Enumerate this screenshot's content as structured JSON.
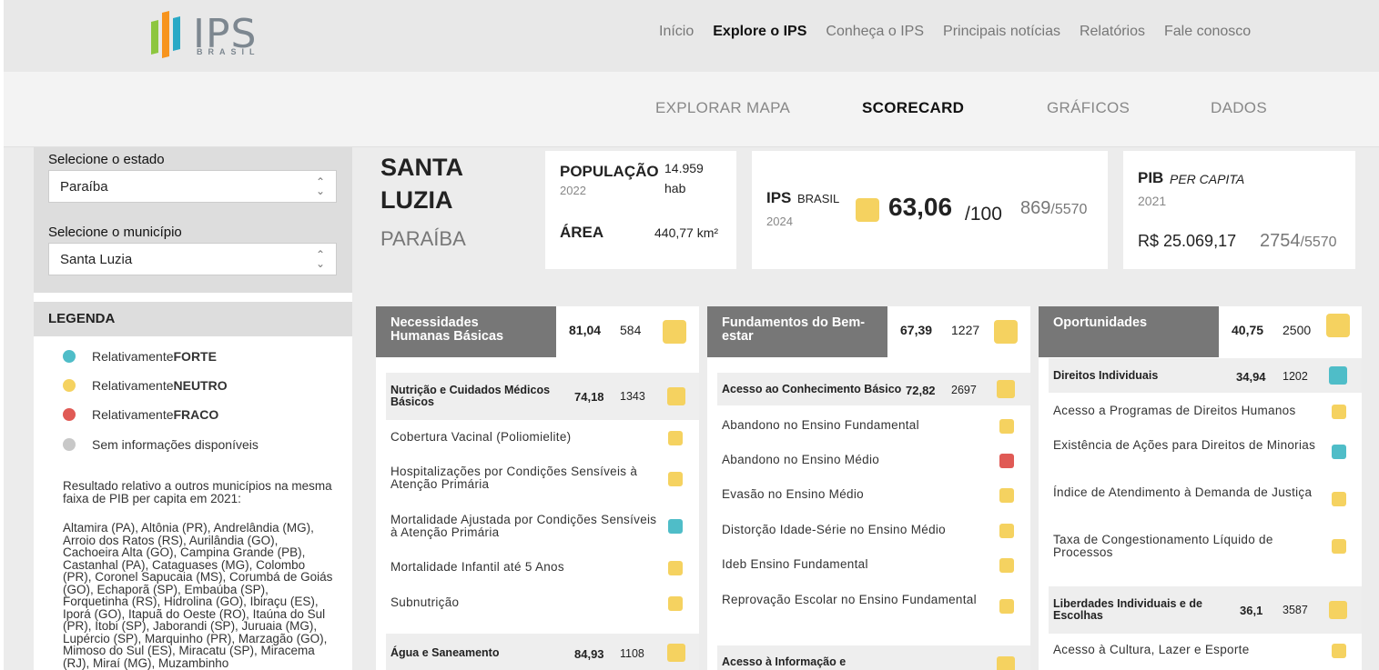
{
  "colors": {
    "forte": "#4fbdc8",
    "neutro": "#f5d260",
    "fraco": "#e05a55",
    "sem_info": "#c8c8c8"
  },
  "logo": {
    "text": "IPS",
    "sub": "BRASIL"
  },
  "nav": {
    "items": [
      "Início",
      "Explore o IPS",
      "Conheça o IPS",
      "Principais notícias",
      "Relatórios",
      "Fale conosco"
    ],
    "active": "Explore o IPS"
  },
  "subnav": {
    "mapa": "EXPLORAR MAPA",
    "scorecard": "SCORECARD",
    "graficos": "GRÁFICOS",
    "dados": "DADOS"
  },
  "sidebar": {
    "estado_label": "Selecione o estado",
    "estado_value": "Paraíba",
    "municipio_label": "Selecione o município",
    "municipio_value": "Santa Luzia",
    "legend_title": "LEGENDA",
    "legend": [
      {
        "prefix": "Relativamente ",
        "bold": "FORTE",
        "color": "forte"
      },
      {
        "prefix": "Relativamente ",
        "bold": "NEUTRO",
        "color": "neutro"
      },
      {
        "prefix": "Relativamente ",
        "bold": "FRACO",
        "color": "fraco"
      },
      {
        "prefix": "Sem informações disponíveis",
        "bold": "",
        "color": "sem_info"
      }
    ],
    "note": "Resultado relativo a outros municípios na mesma faixa de PIB per capita em 2021:",
    "municipios": "Altamira (PA), Altônia (PR), Andrelândia (MG), Arroio dos Ratos (RS), Aurilândia (GO), Cachoeira Alta (GO), Campina Grande (PB), Castanhal (PA), Cataguases (MG), Colombo (PR), Coronel Sapucaia (MS), Corumbá de Goiás (GO), Echaporã (SP), Embaúba (SP), Forquetinha (RS), Hidrolina (GO), Ibiraçu (ES), Iporá (GO), Itapuã do Oeste (RO), Itaúna do Sul (PR), Itobi (SP), Jaborandi (SP), Juruaia (MG), Lupércio (SP), Marquinho (PR), Marzagão (GO), Mimoso do Sul (ES), Miracatu (SP), Miracema (RJ), Miraí (MG), Muzambinho"
  },
  "city": {
    "name_line1": "SANTA",
    "name_line2": "LUZIA",
    "state": "PARAÍBA"
  },
  "pop_card": {
    "pop_label": "POPULAÇÃO",
    "pop_year": "2022",
    "pop_value": "14.959",
    "pop_unit": "hab",
    "area_label": "ÁREA",
    "area_value": "440,77 km²"
  },
  "ips_card": {
    "label": "IPS",
    "label_small": "BRASIL",
    "year": "2024",
    "score": "63,06",
    "max": "/100",
    "rank": "869",
    "total": "/5570"
  },
  "pib_card": {
    "label": "PIB",
    "label_italic": "PER CAPITA",
    "year": "2021",
    "value": "R$ 25.069,17",
    "rank": "2754",
    "total": "/5570"
  },
  "dimensions": [
    {
      "title": "Necessidades Humanas Básicas",
      "score": "81,04",
      "rank": "584",
      "color": "neutro",
      "components": [
        {
          "title": "Nutrição e Cuidados Médicos Básicos",
          "score": "74,18",
          "rank": "1343",
          "color": "neutro",
          "indicators": [
            {
              "name": "Cobertura Vacinal (Poliomielite)",
              "color": "neutro"
            },
            {
              "name": "Hospitalizações por Condições Sensíveis à Atenção Primária",
              "color": "neutro"
            },
            {
              "name": "Mortalidade Ajustada por Condições Sensíveis à Atenção Primária",
              "color": "forte"
            },
            {
              "name": "Mortalidade Infantil até 5 Anos",
              "color": "neutro"
            },
            {
              "name": "Subnutrição",
              "color": "neutro"
            }
          ]
        },
        {
          "title": "Água e Saneamento",
          "score": "84,93",
          "rank": "1108",
          "color": "neutro",
          "indicators": []
        }
      ]
    },
    {
      "title": "Fundamentos do Bem-estar",
      "score": "67,39",
      "rank": "1227",
      "color": "neutro",
      "components": [
        {
          "title": "Acesso ao Conhecimento Básico",
          "score": "72,82",
          "rank": "2697",
          "color": "neutro",
          "indicators": [
            {
              "name": "Abandono no Ensino Fundamental",
              "color": "neutro"
            },
            {
              "name": "Abandono no Ensino Médio",
              "color": "fraco"
            },
            {
              "name": "Evasão no Ensino Médio",
              "color": "neutro"
            },
            {
              "name": "Distorção Idade-Série no Ensino Médio",
              "color": "neutro"
            },
            {
              "name": "Ideb Ensino Fundamental",
              "color": "neutro"
            },
            {
              "name": "Reprovação Escolar no Ensino Fundamental",
              "color": "neutro"
            }
          ]
        },
        {
          "title": "Acesso à Informação e",
          "score": "",
          "rank": "",
          "color": "neutro",
          "indicators": []
        }
      ]
    },
    {
      "title": "Oportunidades",
      "score": "40,75",
      "rank": "2500",
      "color": "neutro",
      "components": [
        {
          "title": "Direitos Individuais",
          "score": "34,94",
          "rank": "1202",
          "color": "forte",
          "indicators": [
            {
              "name": "Acesso a Programas de Direitos Humanos",
              "color": "neutro"
            },
            {
              "name": "Existência de Ações para Direitos de Minorias",
              "color": "forte"
            },
            {
              "name": "Índice de Atendimento à Demanda de Justiça",
              "color": "neutro"
            },
            {
              "name": "Taxa de Congestionamento Líquido de Processos",
              "color": "neutro"
            }
          ]
        },
        {
          "title": "Liberdades Individuais e de Escolhas",
          "score": "36,1",
          "rank": "3587",
          "color": "neutro",
          "indicators": [
            {
              "name": "Acesso à Cultura, Lazer e Esporte",
              "color": "neutro"
            }
          ]
        }
      ]
    }
  ]
}
